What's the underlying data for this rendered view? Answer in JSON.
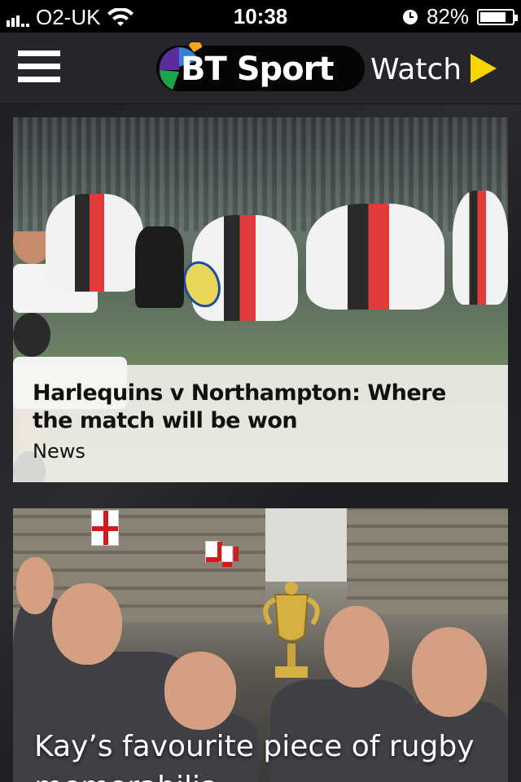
{
  "status_bar": {
    "carrier": "O2-UK",
    "time": "10:38",
    "battery": "82%",
    "battery_level": 0.82
  },
  "header": {
    "logo_text": "BT Sport",
    "watch_label": "Watch"
  },
  "feed": {
    "cards": [
      {
        "headline": "Harlequins v Northampton: Where the match will be won",
        "section": "News"
      },
      {
        "headline": "Kay’s favourite piece of rugby memorabilia"
      }
    ]
  },
  "colors": {
    "header_bg": "#25262b",
    "accent_yellow": "#f7d600",
    "caption_bg": "#f5f5f0"
  }
}
